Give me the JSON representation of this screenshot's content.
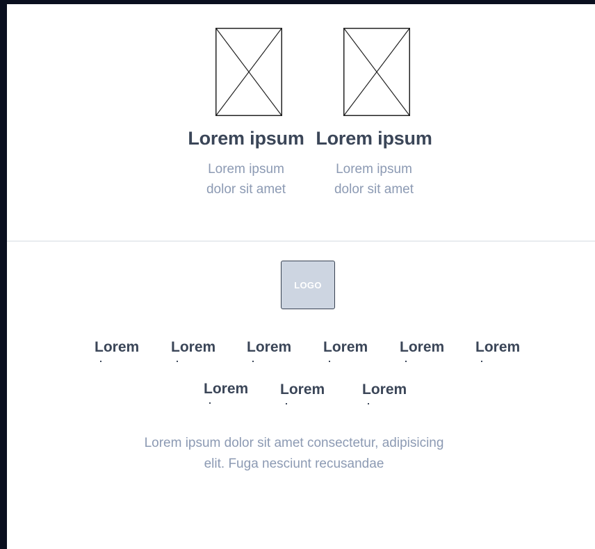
{
  "features": [
    {
      "title": "Lorem ipsum",
      "description": "Lorem ipsum dolor sit amet",
      "image_icon": "image-placeholder-icon"
    },
    {
      "title": "Lorem ipsum",
      "description": "Lorem ipsum dolor sit amet",
      "image_icon": "image-placeholder-icon"
    }
  ],
  "footer": {
    "logo_text": "LOGO",
    "nav_row1": [
      "Lorem",
      "Lorem",
      "Lorem",
      "Lorem",
      "Lorem",
      "Lorem"
    ],
    "nav_row2": [
      "Lorem",
      "Lorem",
      "Lorem"
    ],
    "text": "Lorem ipsum dolor sit amet consectetur, adipisicing elit. Fuga nesciunt recusandae"
  },
  "colors": {
    "heading": "#3b4658",
    "muted_text": "#8c9ab3",
    "logo_bg": "#cdd5e1",
    "frame_bg": "#0a0f1f"
  }
}
